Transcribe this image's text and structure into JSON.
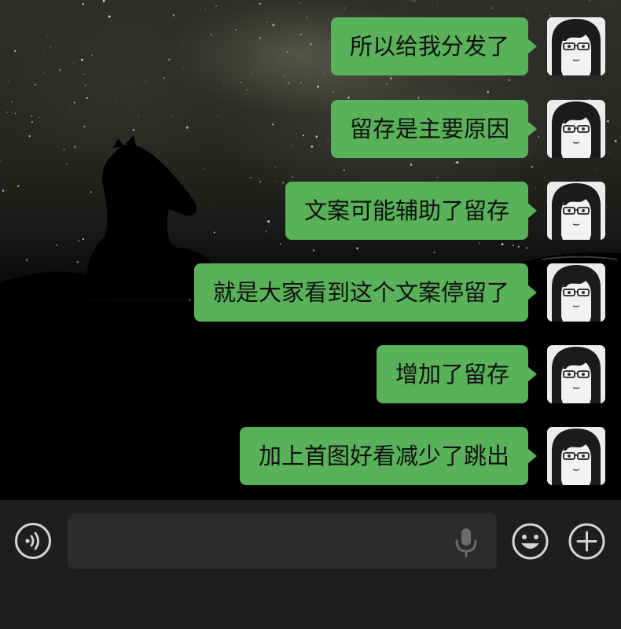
{
  "chat": {
    "messages": [
      {
        "text": "所以给我分发了",
        "sender": "self"
      },
      {
        "text": "留存是主要原因",
        "sender": "self"
      },
      {
        "text": "文案可能辅助了留存",
        "sender": "self"
      },
      {
        "text": "就是大家看到这个文案停留了",
        "sender": "self"
      },
      {
        "text": "增加了留存",
        "sender": "self"
      },
      {
        "text": "加上首图好看减少了跳出",
        "sender": "self"
      }
    ],
    "bubble_color": "#59b159"
  },
  "input_bar": {
    "voice_icon": "voice-wave-icon",
    "mic_icon": "microphone-icon",
    "emoji_icon": "smiley-face-icon",
    "plus_icon": "plus-circle-icon",
    "background": "#1e1e1e"
  }
}
